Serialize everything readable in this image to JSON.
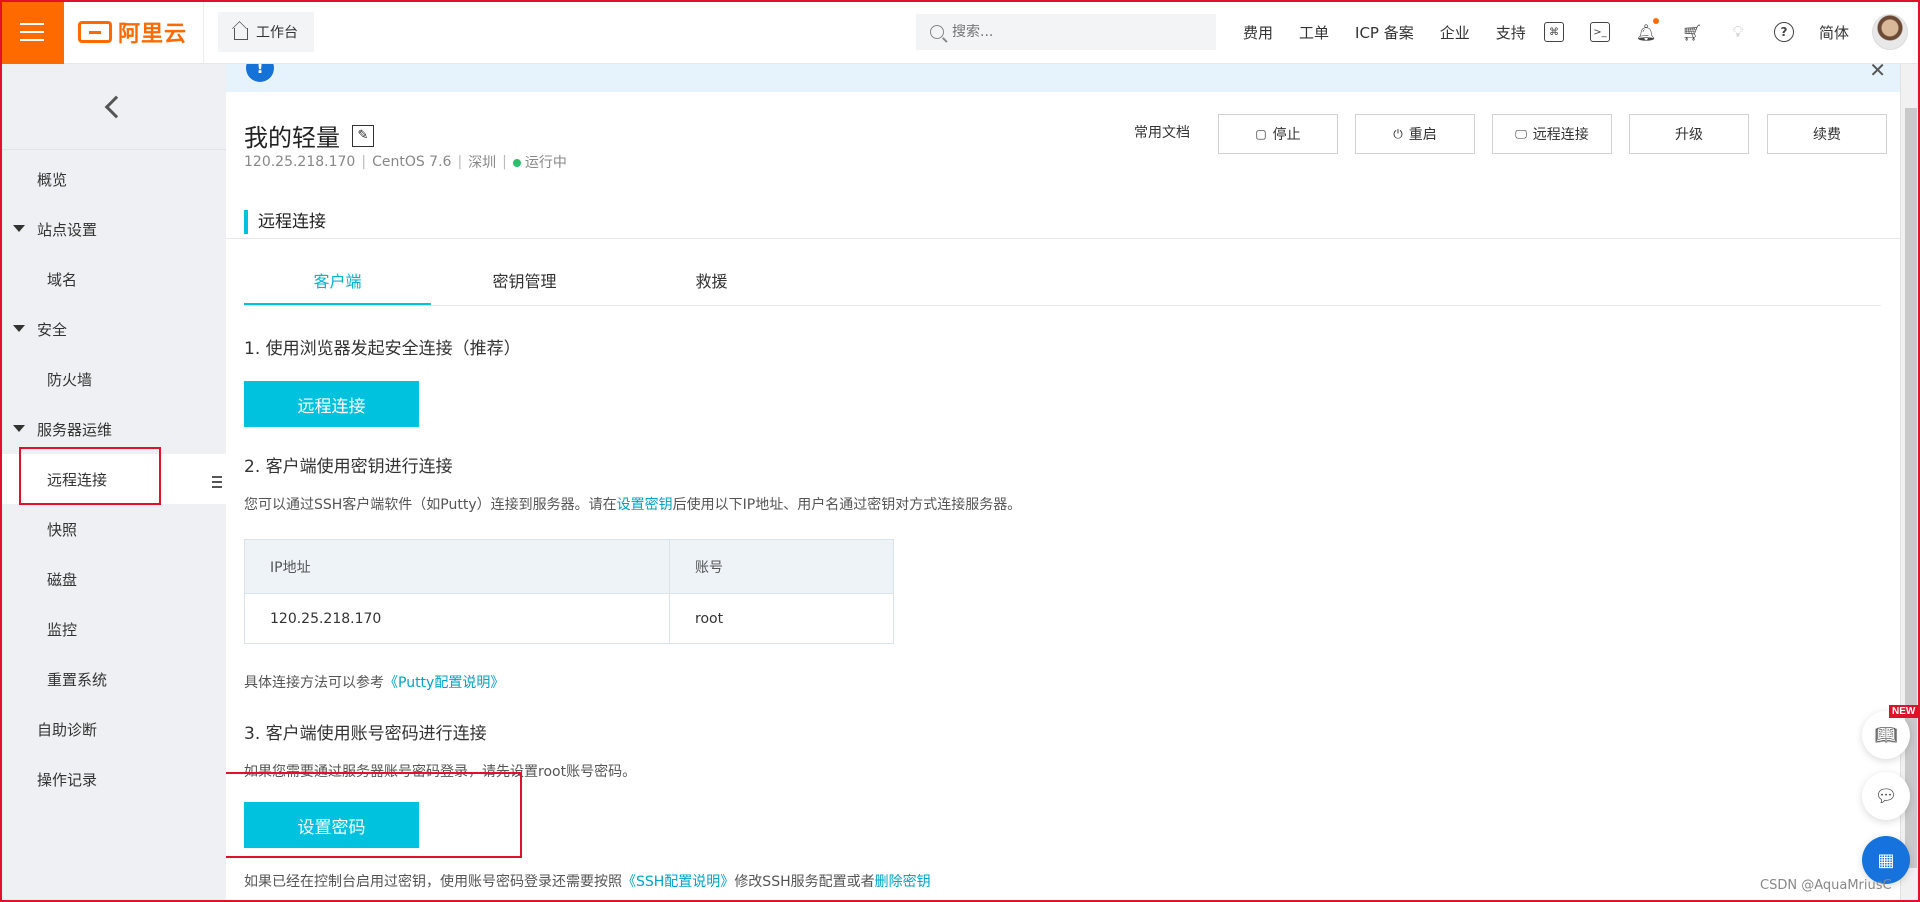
{
  "topbar": {
    "logo_text": "阿里云",
    "workbench": "工作台",
    "search_placeholder": "搜索...",
    "links": [
      "费用",
      "工单",
      "ICP 备案",
      "企业",
      "支持"
    ],
    "lang": "简体",
    "accent": "#ff6a00"
  },
  "sidebar": {
    "items": [
      {
        "label": "概览",
        "kind": "top"
      },
      {
        "label": "站点设置",
        "kind": "group"
      },
      {
        "label": "域名",
        "kind": "sub"
      },
      {
        "label": "安全",
        "kind": "group"
      },
      {
        "label": "防火墙",
        "kind": "sub"
      },
      {
        "label": "服务器运维",
        "kind": "group"
      },
      {
        "label": "远程连接",
        "kind": "sub",
        "active": true
      },
      {
        "label": "快照",
        "kind": "sub"
      },
      {
        "label": "磁盘",
        "kind": "sub"
      },
      {
        "label": "监控",
        "kind": "sub"
      },
      {
        "label": "重置系统",
        "kind": "sub"
      },
      {
        "label": "自助诊断",
        "kind": "top"
      },
      {
        "label": "操作记录",
        "kind": "top"
      }
    ]
  },
  "instance": {
    "name": "我的轻量",
    "ip": "120.25.218.170",
    "os": "CentOS 7.6",
    "region": "深圳",
    "status": "运行中",
    "status_color": "#2bbf6c"
  },
  "actions": {
    "docs": "常用文档",
    "stop": "停止",
    "restart": "重启",
    "remote": "远程连接",
    "upgrade": "升级",
    "renew": "续费"
  },
  "section": {
    "title": "远程连接",
    "tabs": [
      "客户端",
      "密钥管理",
      "救援"
    ],
    "step1": "1. 使用浏览器发起安全连接（推荐）",
    "step1_btn": "远程连接",
    "step2": "2. 客户端使用密钥进行连接",
    "step2_desc_a": "您可以通过SSH客户端软件（如Putty）连接到服务器。请在",
    "step2_desc_link": "设置密钥",
    "step2_desc_b": "后使用以下IP地址、用户名通过密钥对方式连接服务器。",
    "table": {
      "headers": [
        "IP地址",
        "账号"
      ],
      "rows": [
        [
          "120.25.218.170",
          "root"
        ]
      ]
    },
    "putty_a": "具体连接方法可以参考",
    "putty_link": "《Putty配置说明》",
    "step3": "3. 客户端使用账号密码进行连接",
    "step3_desc": "如果您需要通过服务器账号密码登录，请先设置root账号密码。",
    "step3_btn": "设置密码",
    "ssh_a": "如果已经在控制台启用过密钥，使用账号密码登录还需要按照",
    "ssh_link": "《SSH配置说明》",
    "ssh_b": "修改SSH服务配置或者",
    "ssh_link2": "删除密钥"
  },
  "float": {
    "new_badge": "NEW"
  },
  "watermark": "CSDN @AquaMriusC"
}
